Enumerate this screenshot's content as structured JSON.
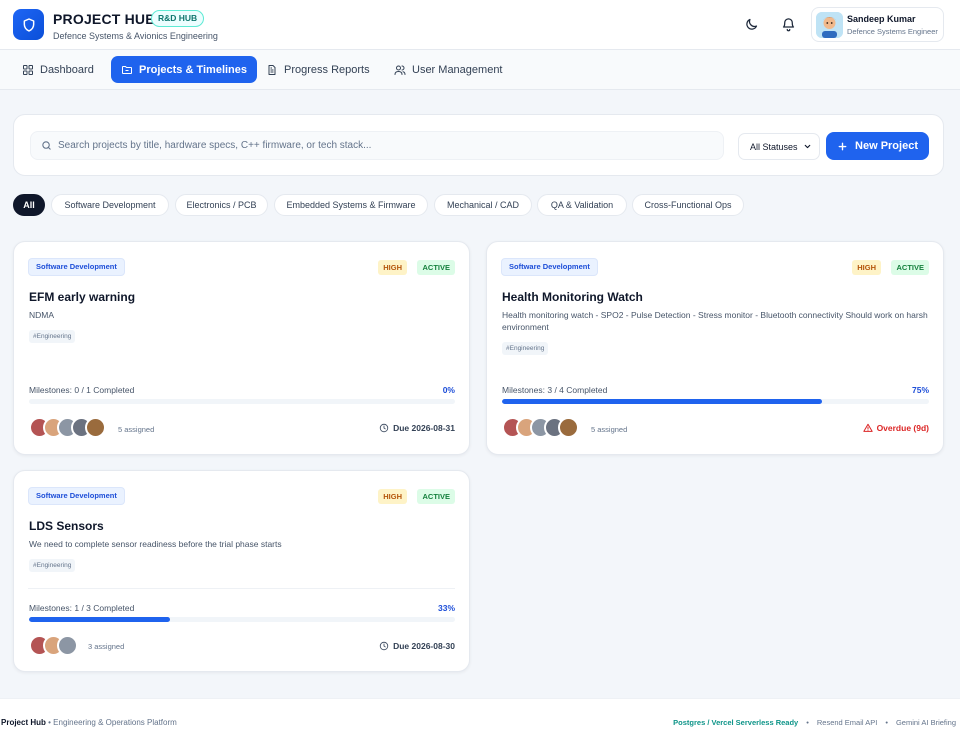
{
  "header": {
    "title": "PROJECT HUB",
    "badge": "R&D HUB",
    "subtitle": "Defence Systems & Avionics Engineering",
    "user": {
      "name": "Sandeep Kumar",
      "role": "Defence Systems Engineer"
    },
    "icons": [
      "shield-icon",
      "moon-icon",
      "bell-icon"
    ]
  },
  "nav": {
    "items": [
      {
        "label": "Dashboard",
        "icon": "grid-icon"
      },
      {
        "label": "Projects & Timelines",
        "icon": "folder-icon"
      },
      {
        "label": "Progress Reports",
        "icon": "document-icon"
      },
      {
        "label": "User Management",
        "icon": "users-icon"
      }
    ],
    "active": "Projects & Timelines"
  },
  "search": {
    "placeholder": "Search projects by title, hardware specs, C++ firmware, or tech stack...",
    "status_filter": "All Statuses",
    "new_button": "New Project"
  },
  "filters": [
    "All",
    "Software Development",
    "Electronics / PCB",
    "Embedded Systems & Firmware",
    "Mechanical / CAD",
    "QA & Validation",
    "Cross-Functional Ops"
  ],
  "projects": [
    {
      "category": "Software Development",
      "priority": "HIGH",
      "status": "ACTIVE",
      "title": "EFM early warning",
      "description": "NDMA",
      "tag": "#Engineering",
      "milestones": "Milestones: 0 / 1 Completed",
      "percent_label": "0%",
      "progress": 0,
      "assigned": "5 assigned",
      "due": "Due 2026-08-31"
    },
    {
      "category": "Software Development",
      "priority": "HIGH",
      "status": "ACTIVE",
      "title": "Health Monitoring Watch",
      "description": "Health monitoring watch - SPO2 - Pulse Detection - Stress monitor - Bluetooth connectivity Should work on harsh environment",
      "tag": "#Engineering",
      "milestones": "Milestones: 3 / 4 Completed",
      "percent_label": "75%",
      "progress": 0.75,
      "assigned": "5 assigned",
      "due": "Overdue (9d)"
    },
    {
      "category": "Software Development",
      "priority": "HIGH",
      "status": "ACTIVE",
      "title": "LDS Sensors",
      "description": "We need to complete sensor readiness before the trial phase starts",
      "tag": "#Engineering",
      "milestones": "Milestones: 1 / 3 Completed",
      "percent_label": "33%",
      "progress": 0.33,
      "assigned": "3 assigned",
      "due": "Due 2026-08-30"
    }
  ],
  "footer": {
    "brand": "Project Hub",
    "tagline": "• Engineering & Operations Platform",
    "status": "Postgres / Vercel Serverless Ready",
    "email": "Resend Email API",
    "ai": "Gemini AI Briefing",
    "sep": "•"
  },
  "colors": {
    "accent": "#1f63ee",
    "overdue": "#dc2626",
    "priority": "#b45309",
    "active": "#15803d"
  }
}
